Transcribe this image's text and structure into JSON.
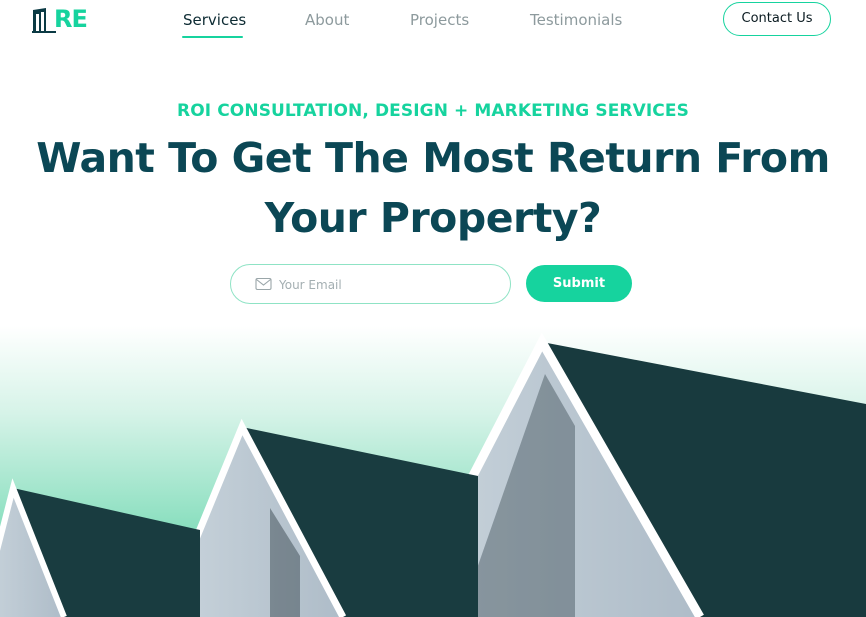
{
  "nav": {
    "logo_text": "RE",
    "links": [
      {
        "label": "Services",
        "active": true
      },
      {
        "label": "About",
        "active": false
      },
      {
        "label": "Projects",
        "active": false
      },
      {
        "label": "Testimonials",
        "active": false
      }
    ],
    "contact_label": "Contact Us"
  },
  "hero": {
    "eyebrow": "ROI CONSULTATION, DESIGN + MARKETING SERVICES",
    "headline_line1": "Want To Get The Most Return From",
    "headline_line2": "Your Property?"
  },
  "signup": {
    "placeholder": "Your Email",
    "submit_label": "Submit"
  },
  "colors": {
    "accent": "#16d39e",
    "heading": "#0b4755",
    "roof": "#173a3d"
  },
  "icons": {
    "logo": "building-logo-icon",
    "email": "mail-icon"
  }
}
